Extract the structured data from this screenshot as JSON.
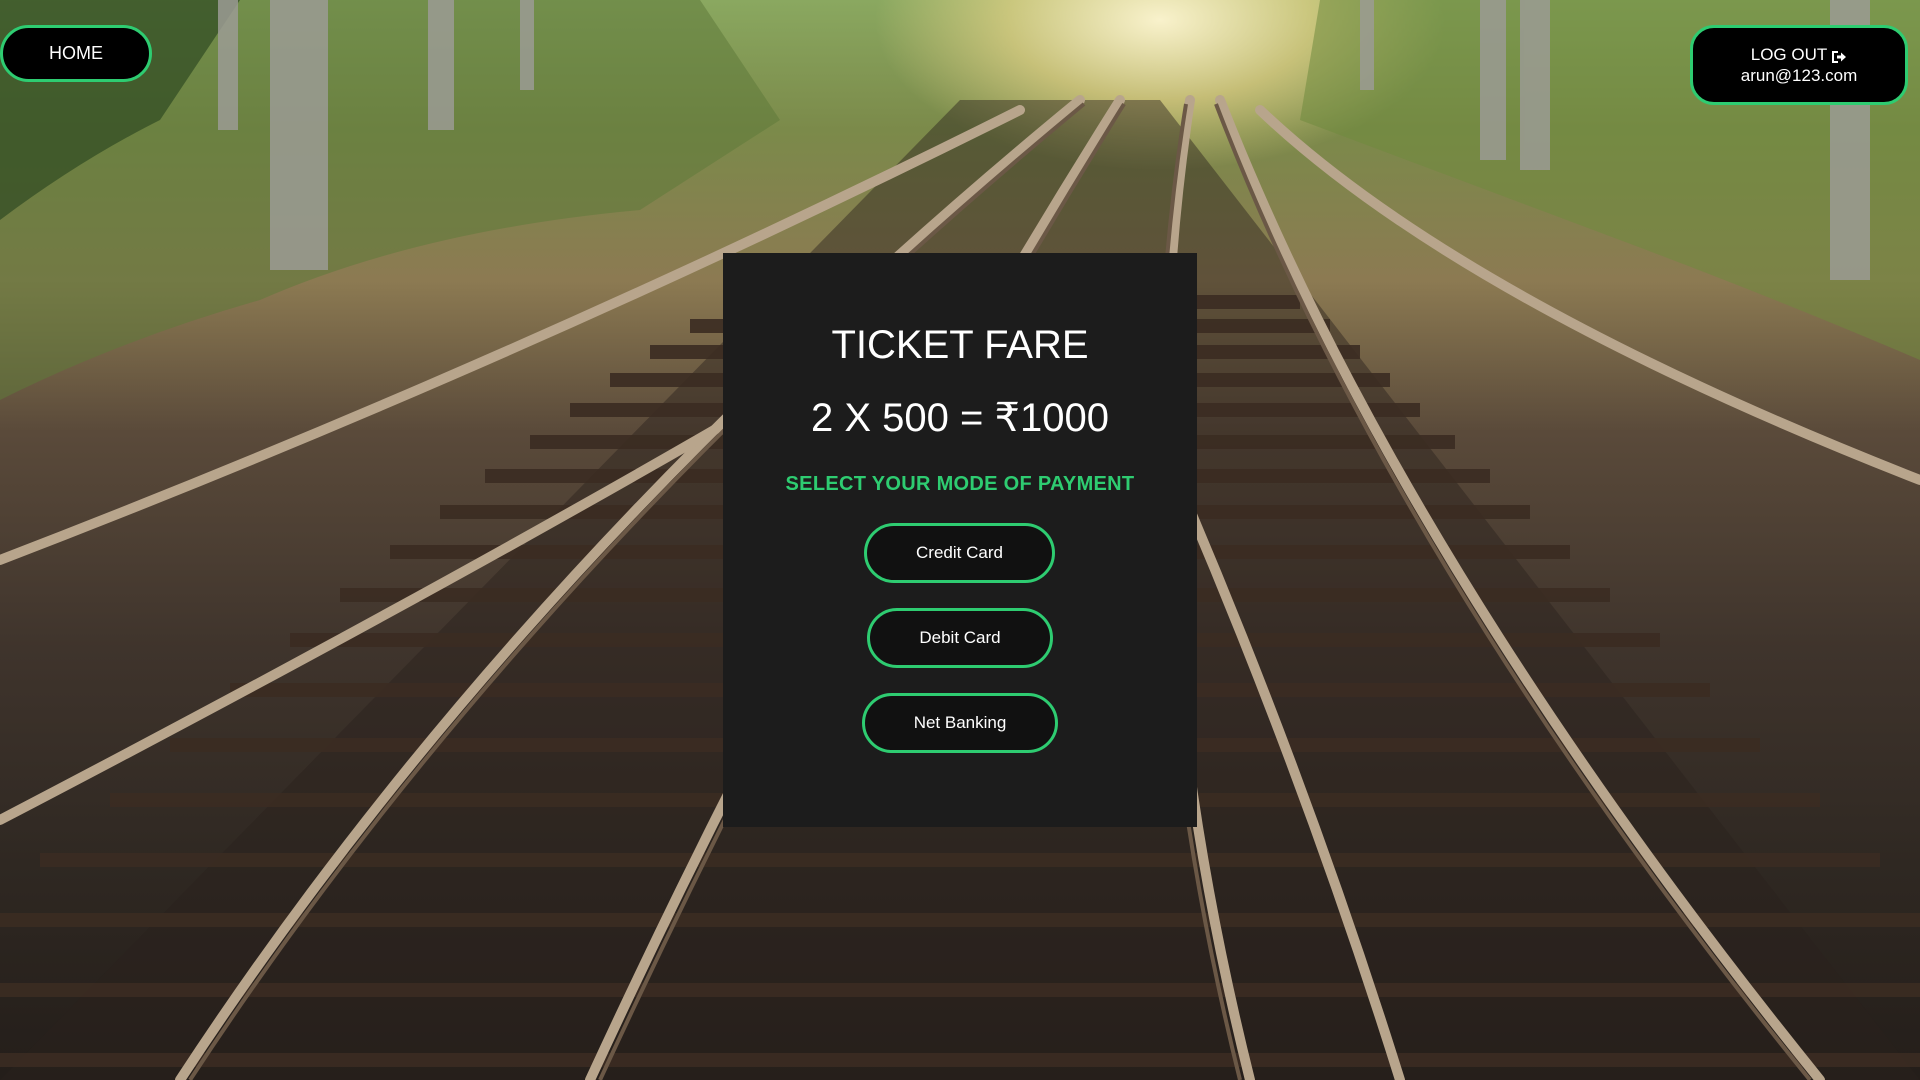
{
  "nav": {
    "home_label": "HOME",
    "logout_label": "LOG OUT",
    "user_email": "arun@123.com"
  },
  "fare": {
    "title": "TICKET FARE",
    "calculation": "2 X 500 = ₹1000"
  },
  "payment": {
    "heading": "SELECT YOUR MODE OF PAYMENT",
    "options": [
      "Credit Card",
      "Debit Card",
      "Net Banking"
    ]
  },
  "colors": {
    "accent": "#2ecc71",
    "panel": "#1c1c1c",
    "button_bg": "#000000"
  },
  "icons": {
    "logout": "sign-out-icon"
  }
}
